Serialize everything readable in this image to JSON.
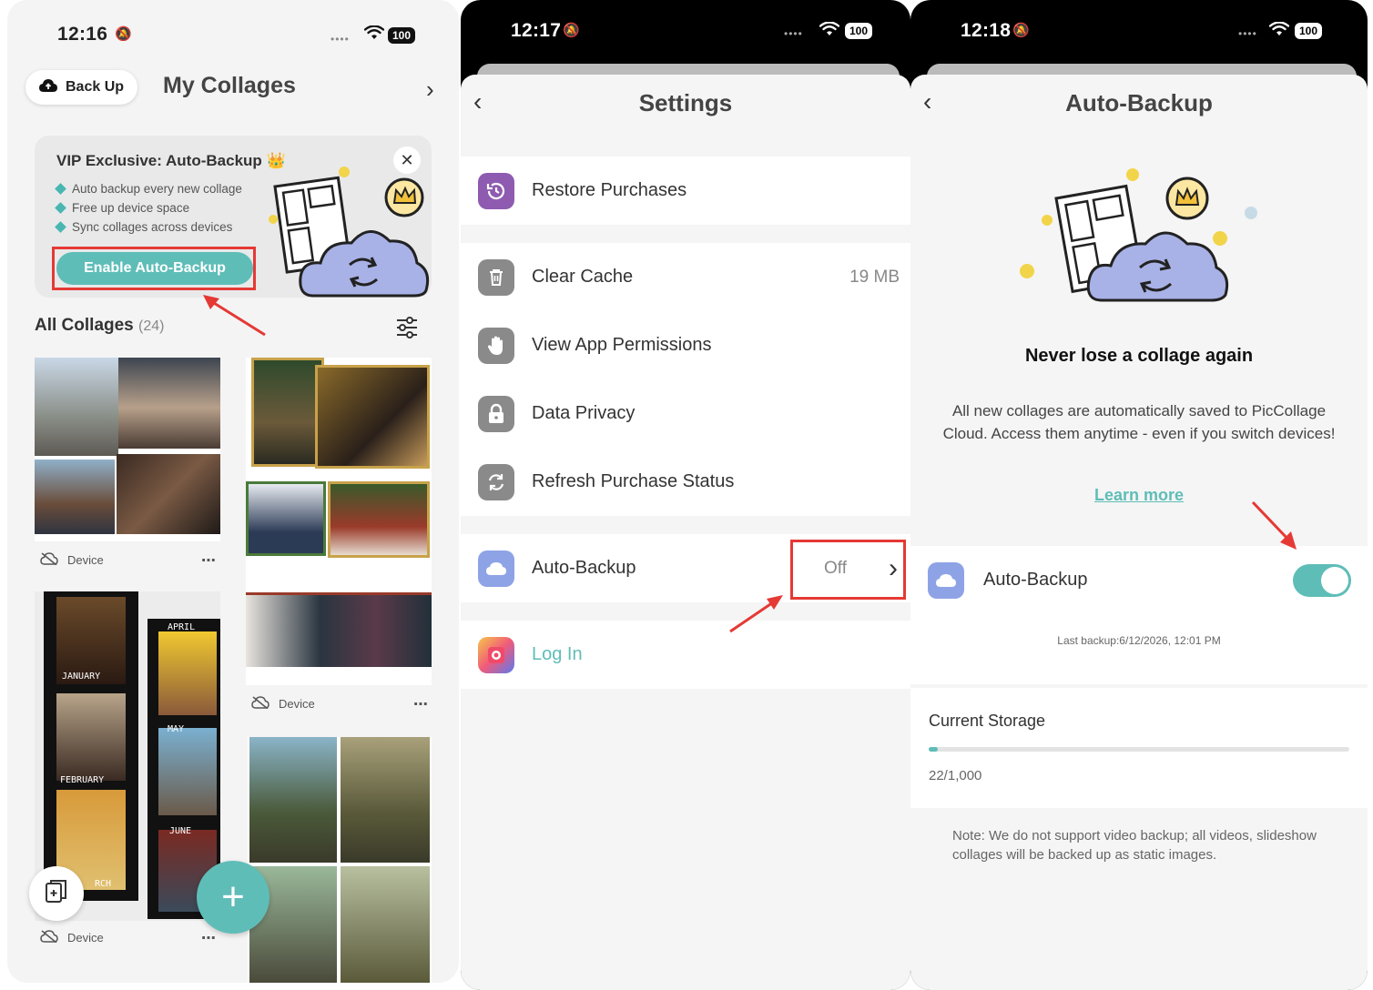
{
  "screen1": {
    "time": "12:16",
    "battery": "100",
    "backup_button": "Back Up",
    "title": "My Collages",
    "vip_title": "VIP Exclusive: Auto-Backup",
    "vip_features": [
      "Auto backup every new collage",
      "Free up device space",
      "Sync collages across devices"
    ],
    "vip_cta": "Enable Auto-Backup",
    "all_title": "All Collages",
    "all_count": "(24)",
    "card_meta": "Device",
    "collage_labels": [
      "APRIL",
      "JANUARY",
      "MAY",
      "FEBRUARY",
      "JUNE",
      "RCH"
    ]
  },
  "screen2": {
    "time": "12:17",
    "battery": "100",
    "title": "Settings",
    "rows": [
      {
        "label": "Restore Purchases",
        "value": ""
      },
      {
        "label": "Clear Cache",
        "value": "19 MB"
      },
      {
        "label": "View App Permissions",
        "value": ""
      },
      {
        "label": "Data Privacy",
        "value": ""
      },
      {
        "label": "Refresh Purchase Status",
        "value": ""
      },
      {
        "label": "Auto-Backup",
        "value": "Off"
      },
      {
        "label": "Log In",
        "value": ""
      }
    ]
  },
  "screen3": {
    "time": "12:18",
    "battery": "100",
    "title": "Auto-Backup",
    "headline": "Never lose a collage again",
    "description": "All new collages are automatically saved to PicCollage Cloud. Access them anytime - even if you switch devices!",
    "learn_more": "Learn more",
    "toggle_label": "Auto-Backup",
    "toggle_on": true,
    "last_backup": "Last backup:6/12/2026, 12:01 PM",
    "storage_title": "Current Storage",
    "storage_value": "22/1,000",
    "storage_used": 22,
    "storage_total": 1000,
    "note": "Note: We do not support video backup; all videos, slideshow collages will be backed up as static images."
  },
  "colors": {
    "accent": "#5fbdb8",
    "highlight_red": "#e53935",
    "restore_icon": "#8e5bb0",
    "grey_icon": "#8a8a8a",
    "cloud_icon": "#8ea3e6"
  }
}
